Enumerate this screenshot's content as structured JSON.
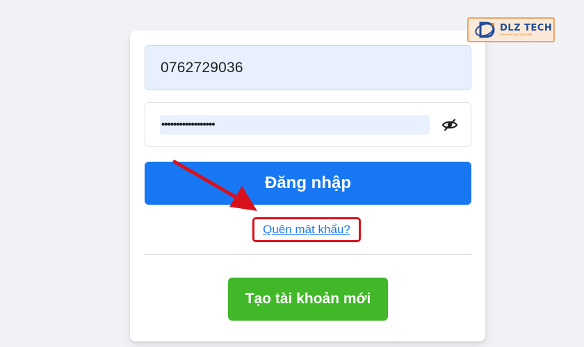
{
  "login_form": {
    "phone_value": "0762729036",
    "password_mask": "••••••••••••••••••",
    "login_label": "Đăng nhập",
    "forgot_label": "Quên mật khẩu?",
    "create_account_label": "Tạo tài khoản mới"
  },
  "icons": {
    "password_toggle": "eye-slash-icon"
  },
  "watermark": {
    "brand": "DLZ TECH",
    "tagline": "Thành Mới Tạo Giá Trị Mới"
  },
  "annotation": {
    "arrow_color": "#d9111c",
    "highlight_color": "#d9111c"
  },
  "colors": {
    "primary": "#1877f2",
    "success": "#42b72a",
    "autofill_bg": "#e8f0fe",
    "page_bg": "#f0f2f5"
  }
}
